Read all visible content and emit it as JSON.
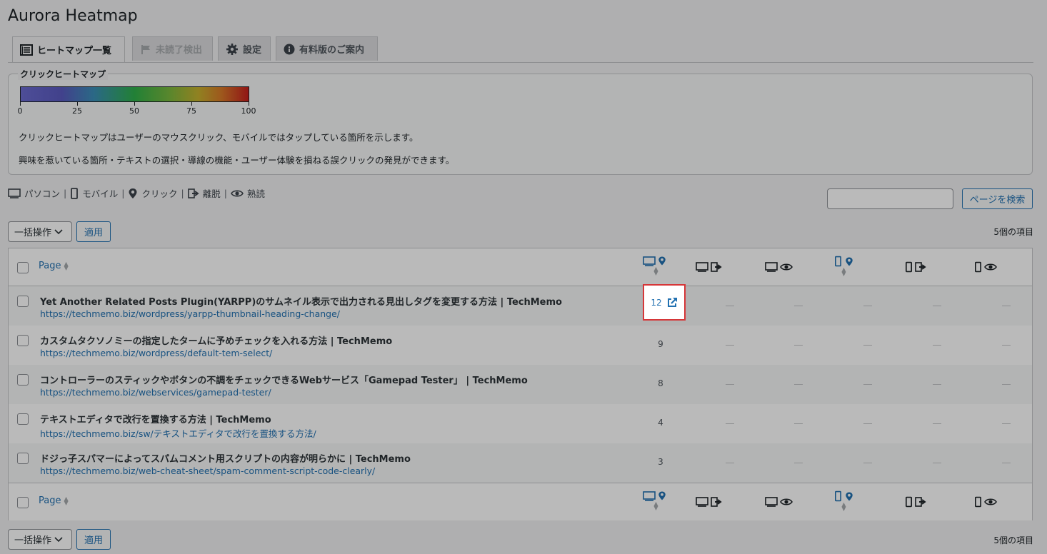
{
  "app_title": "Aurora Heatmap",
  "tabs": [
    {
      "label": "ヒートマップ一覧",
      "icon": "list-icon",
      "state": "active"
    },
    {
      "label": "未読了検出",
      "icon": "flag-icon",
      "state": "disabled"
    },
    {
      "label": "設定",
      "icon": "gear-icon",
      "state": "normal"
    },
    {
      "label": "有料版のご案内",
      "icon": "info-icon",
      "state": "normal"
    }
  ],
  "legend": {
    "title": "クリックヒートマップ",
    "ticks": [
      "0",
      "25",
      "50",
      "75",
      "100"
    ],
    "desc1": "クリックヒートマップはユーザーのマウスクリック、モバイルではタップしている箇所を示します。",
    "desc2": "興味を惹いている箇所・テキストの選択・導線の機能・ユーザー体験を損ねる誤クリックの発見ができます。"
  },
  "icon_legend": {
    "pc": "パソコン",
    "mobile": "モバイル",
    "click": "クリック",
    "exit": "離脱",
    "read": "熟読",
    "sep": "|"
  },
  "search": {
    "button": "ページを検索",
    "placeholder": ""
  },
  "bulk": {
    "select": "一括操作",
    "apply": "適用"
  },
  "item_count": "5個の項目",
  "table": {
    "col_page": "Page",
    "rows": [
      {
        "title": "Yet Another Related Posts Plugin(YARPP)のサムネイル表示で出力される見出しタグを変更する方法 | TechMemo",
        "url": "https://techmemo.biz/wordpress/yarpp-thumbnail-heading-change/",
        "pc_click": "12"
      },
      {
        "title": "カスタムタクソノミーの指定したタームに予めチェックを入れる方法 | TechMemo",
        "url": "https://techmemo.biz/wordpress/default-tem-select/",
        "pc_click": "9"
      },
      {
        "title": "コントローラーのスティックやボタンの不調をチェックできるWebサービス「Gamepad Tester」 | TechMemo",
        "url": "https://techmemo.biz/webservices/gamepad-tester/",
        "pc_click": "8"
      },
      {
        "title": "テキストエディタで改行を置換する方法 | TechMemo",
        "url": "https://techmemo.biz/sw/テキストエディタで改行を置換する方法/",
        "pc_click": "4"
      },
      {
        "title": "ドジっ子スパマーによってスパムコメント用スクリプトの内容が明らかに | TechMemo",
        "url": "https://techmemo.biz/web-cheat-sheet/spam-comment-script-code-clearly/",
        "pc_click": "3"
      }
    ]
  },
  "colors": {
    "accent": "#2271b1",
    "highlight": "#d63638"
  }
}
